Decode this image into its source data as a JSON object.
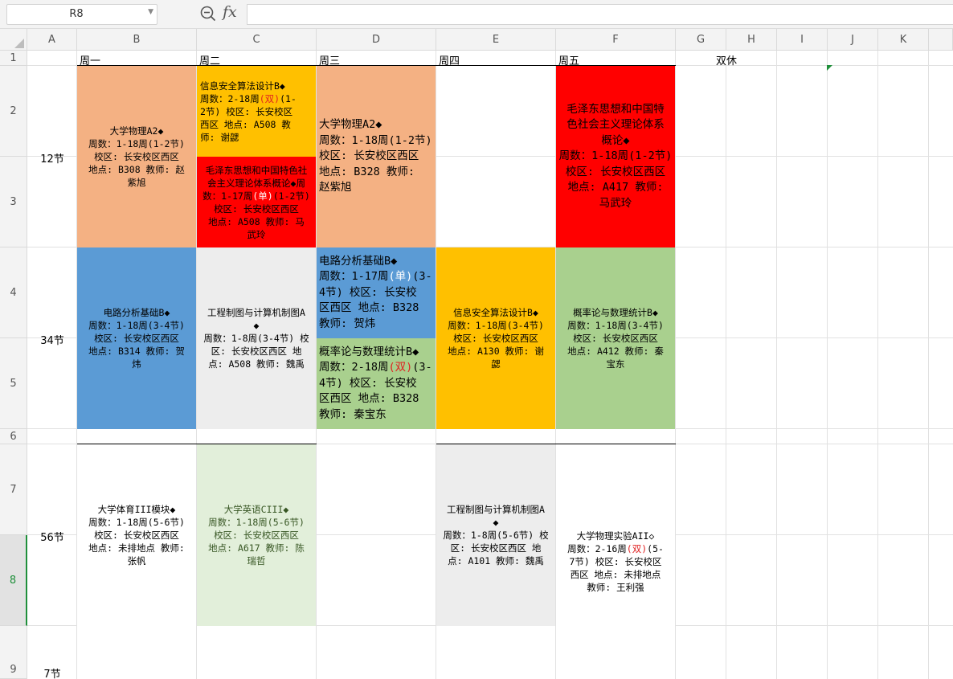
{
  "formula_bar": {
    "name_box": "R8",
    "fx_label": "fx",
    "formula": ""
  },
  "columns": [
    "A",
    "B",
    "C",
    "D",
    "E",
    "F",
    "G",
    "H",
    "I",
    "J",
    "K"
  ],
  "rows": [
    "1",
    "2",
    "3",
    "4",
    "5",
    "6",
    "7",
    "8",
    "9"
  ],
  "selected_row": "8",
  "header_row": {
    "mon": "周一",
    "tue": "周二",
    "wed": "周三",
    "thu": "周四",
    "fri": "周五",
    "weekend": "双休"
  },
  "slots": {
    "s12": "12节",
    "s34": "34节",
    "s56": "56节",
    "s7": "7节"
  },
  "colors": {
    "orange_light": "#f4b183",
    "yellow": "#ffc000",
    "red": "#ff0000",
    "blue": "#5b9bd5",
    "gray": "#ededed",
    "green": "#a9d08e",
    "green_light": "#e2efda",
    "white": "#ffffff",
    "highlight_red": "#e02020",
    "selection_green": "#1f8f3a"
  },
  "courses": {
    "mon_12": [
      "大学物理A2◆",
      "周数：1-18周(1-2节)",
      "校区: 长安校区西区",
      "地点: B308  教师: 赵",
      "紫旭"
    ],
    "tue_12a": [
      [
        {
          "t": "信息安全算法设计B◆"
        }
      ],
      [
        {
          "t": "周数：2-18周"
        },
        {
          "t": "(双)",
          "c": "red"
        },
        {
          "t": "(1-"
        }
      ],
      [
        {
          "t": "2节)  校区: 长安校区"
        }
      ],
      [
        {
          "t": "西区  地点: A508  教"
        }
      ],
      [
        {
          "t": "师: 谢勰"
        }
      ]
    ],
    "tue_12b": [
      [
        {
          "t": "毛泽东思想和中国特色社"
        }
      ],
      [
        {
          "t": "会主义理论体系概论◆周"
        }
      ],
      [
        {
          "t": "数：1-17周"
        },
        {
          "t": "(单)",
          "c": "white"
        },
        {
          "t": "(1-2节)"
        }
      ],
      [
        {
          "t": "校区: 长安校区西区"
        }
      ],
      [
        {
          "t": "地点: A508  教师: 马"
        }
      ],
      [
        {
          "t": "武玲"
        }
      ]
    ],
    "wed_12": [
      "大学物理A2◆",
      "周数：1-18周(1-2节)",
      "校区: 长安校区西区",
      "地点: B328  教师:",
      "赵紫旭"
    ],
    "fri_12": [
      "毛泽东思想和中国特",
      "色社会主义理论体系",
      "概论◆",
      "周数：1-18周(1-2节)",
      "校区: 长安校区西区",
      "地点: A417  教师:",
      "马武玲"
    ],
    "mon_34": [
      "电路分析基础B◆",
      "周数：1-18周(3-4节)",
      "校区: 长安校区西区",
      "地点: B314  教师: 贺",
      "炜"
    ],
    "tue_34": [
      "工程制图与计算机制图A",
      "◆",
      "周数：1-8周(3-4节)  校",
      "区: 长安校区西区  地",
      "点: A508  教师: 魏禹"
    ],
    "wed_34a": [
      [
        {
          "t": "电路分析基础B◆"
        }
      ],
      [
        {
          "t": "周数：1-17周"
        },
        {
          "t": "(单)",
          "c": "white"
        },
        {
          "t": "(3-"
        }
      ],
      [
        {
          "t": "4节)  校区: 长安校"
        }
      ],
      [
        {
          "t": "区西区  地点: B328"
        }
      ],
      [
        {
          "t": "教师: 贺炜"
        }
      ]
    ],
    "wed_34b": [
      [
        {
          "t": "概率论与数理统计B◆"
        }
      ],
      [
        {
          "t": "周数：2-18周"
        },
        {
          "t": "(双)",
          "c": "red"
        },
        {
          "t": "(3-"
        }
      ],
      [
        {
          "t": "4节)  校区: 长安校"
        }
      ],
      [
        {
          "t": "区西区  地点: B328"
        }
      ],
      [
        {
          "t": "教师: 秦宝东"
        }
      ]
    ],
    "thu_34": [
      "信息安全算法设计B◆",
      "周数：1-18周(3-4节)",
      "校区: 长安校区西区",
      "地点: A130  教师: 谢",
      "勰"
    ],
    "fri_34": [
      "概率论与数理统计B◆",
      "周数：1-18周(3-4节)",
      "校区: 长安校区西区",
      "地点: A412  教师: 秦",
      "宝东"
    ],
    "mon_56": [
      "大学体育III模块◆",
      "周数：1-18周(5-6节)",
      "校区: 长安校区西区",
      "地点: 未排地点  教师:",
      "张帆"
    ],
    "tue_56": [
      "大学英语CIII◆",
      "周数：1-18周(5-6节)",
      "校区: 长安校区西区",
      "地点: A617  教师: 陈",
      "瑞哲"
    ],
    "thu_56": [
      "工程制图与计算机制图A",
      "◆",
      "周数：1-8周(5-6节)  校",
      "区: 长安校区西区  地",
      "点: A101  教师: 魏禹"
    ],
    "fri_57": [
      [
        {
          "t": "大学物理实验AII◇"
        }
      ],
      [
        {
          "t": "周数：2-16周"
        },
        {
          "t": "(双)",
          "c": "red"
        },
        {
          "t": "(5-"
        }
      ],
      [
        {
          "t": "7节)  校区: 长安校区"
        }
      ],
      [
        {
          "t": "西区  地点: 未排地点"
        }
      ],
      [
        {
          "t": "教师: 王利强"
        }
      ]
    ]
  }
}
